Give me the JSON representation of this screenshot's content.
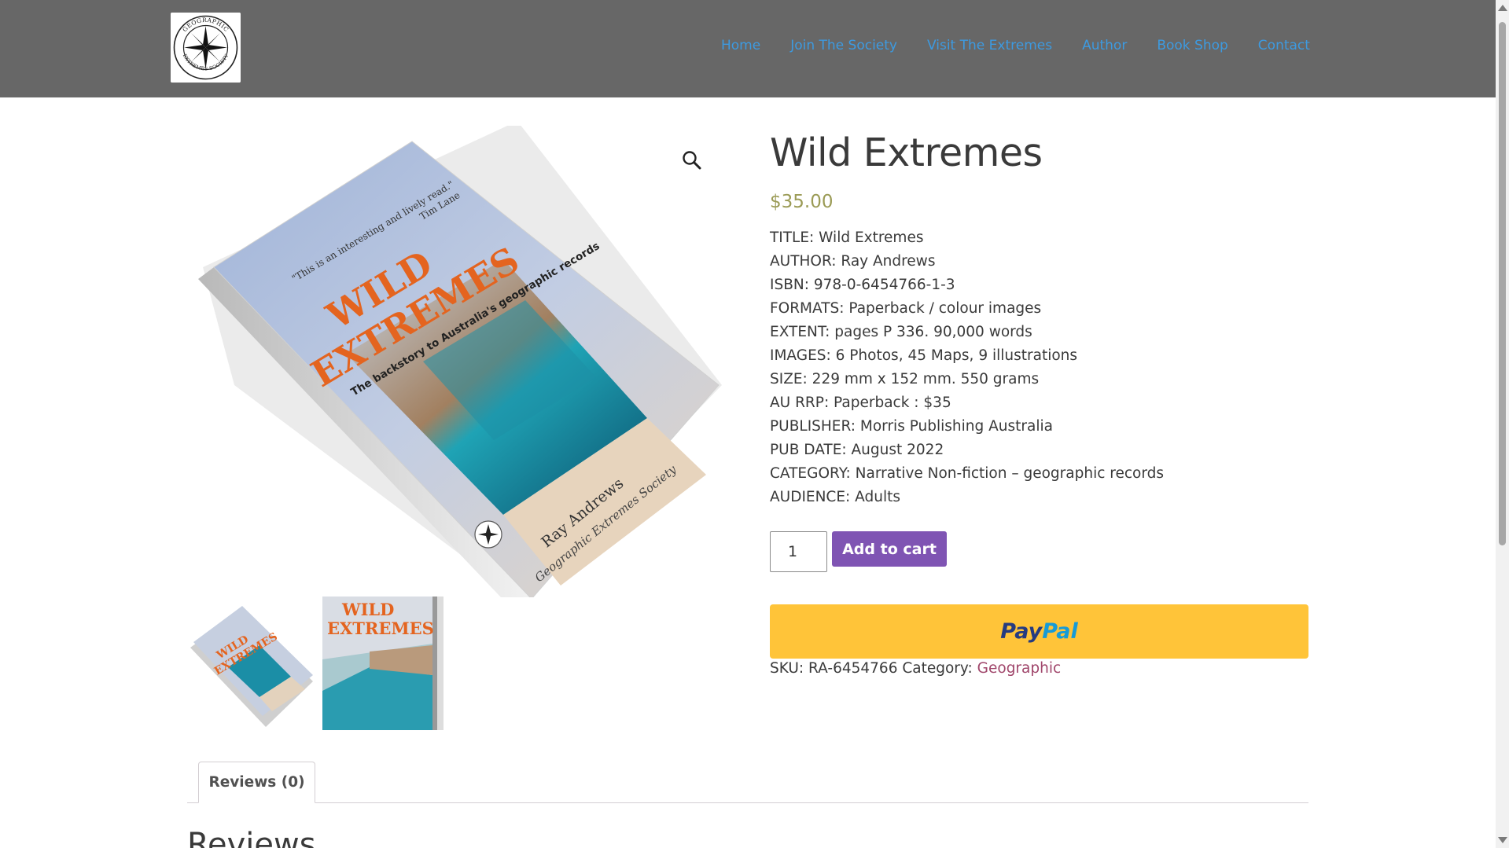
{
  "nav": {
    "items": [
      "Home",
      "Join The Society",
      "Visit The Extremes",
      "Author",
      "Book Shop",
      "Contact"
    ]
  },
  "logo": {
    "ring_text_top": "GEOGRAPHIC",
    "ring_text_bottom": "EXTREMES SOCIETY"
  },
  "product": {
    "title": "Wild Extremes",
    "price": "$35.00",
    "specs": [
      "TITLE: Wild Extremes",
      "AUTHOR: Ray Andrews",
      "ISBN: 978-0-6454766-1-3",
      "FORMATS: Paperback / colour images",
      "EXTENT: pages P 336. 90,000 words",
      "IMAGES: 6 Photos, 45 Maps, 9 illustrations",
      "SIZE: 229 mm x 152 mm. 550 grams",
      "AU RRP: Paperback : $35",
      "PUBLISHER: Morris Publishing Australia",
      "PUB DATE: August 2022",
      "CATEGORY: Narrative Non-fiction – geographic records",
      "AUDIENCE: Adults"
    ],
    "quantity": "1",
    "add_to_cart": "Add to cart",
    "paypal_pay": "Pay",
    "paypal_pal": "Pal",
    "sku_label": "SKU:",
    "sku": "RA-6454766",
    "category_label": "Category:",
    "category": "Geographic"
  },
  "book_cover": {
    "quote": "\"This is an interesting and lively read.\"",
    "quote_author": "Tim Lane",
    "title_line1": "WILD",
    "title_line2": "EXTREMES",
    "subtitle": "The backstory to Australia's geographic records",
    "author": "Ray Andrews",
    "society": "Geographic Extremes Society"
  },
  "tabs": {
    "reviews_tab": "Reviews (0)",
    "reviews_heading": "Reviews"
  },
  "colors": {
    "header_bg": "#676767",
    "nav_link": "#3d9ae0",
    "price": "#9b9b56",
    "cart_button": "#7f54b3",
    "paypal_bg": "#ffc439",
    "category_link": "#a0466b"
  },
  "icons": {
    "zoom": "magnifier-icon",
    "logo": "compass-rose-icon"
  }
}
